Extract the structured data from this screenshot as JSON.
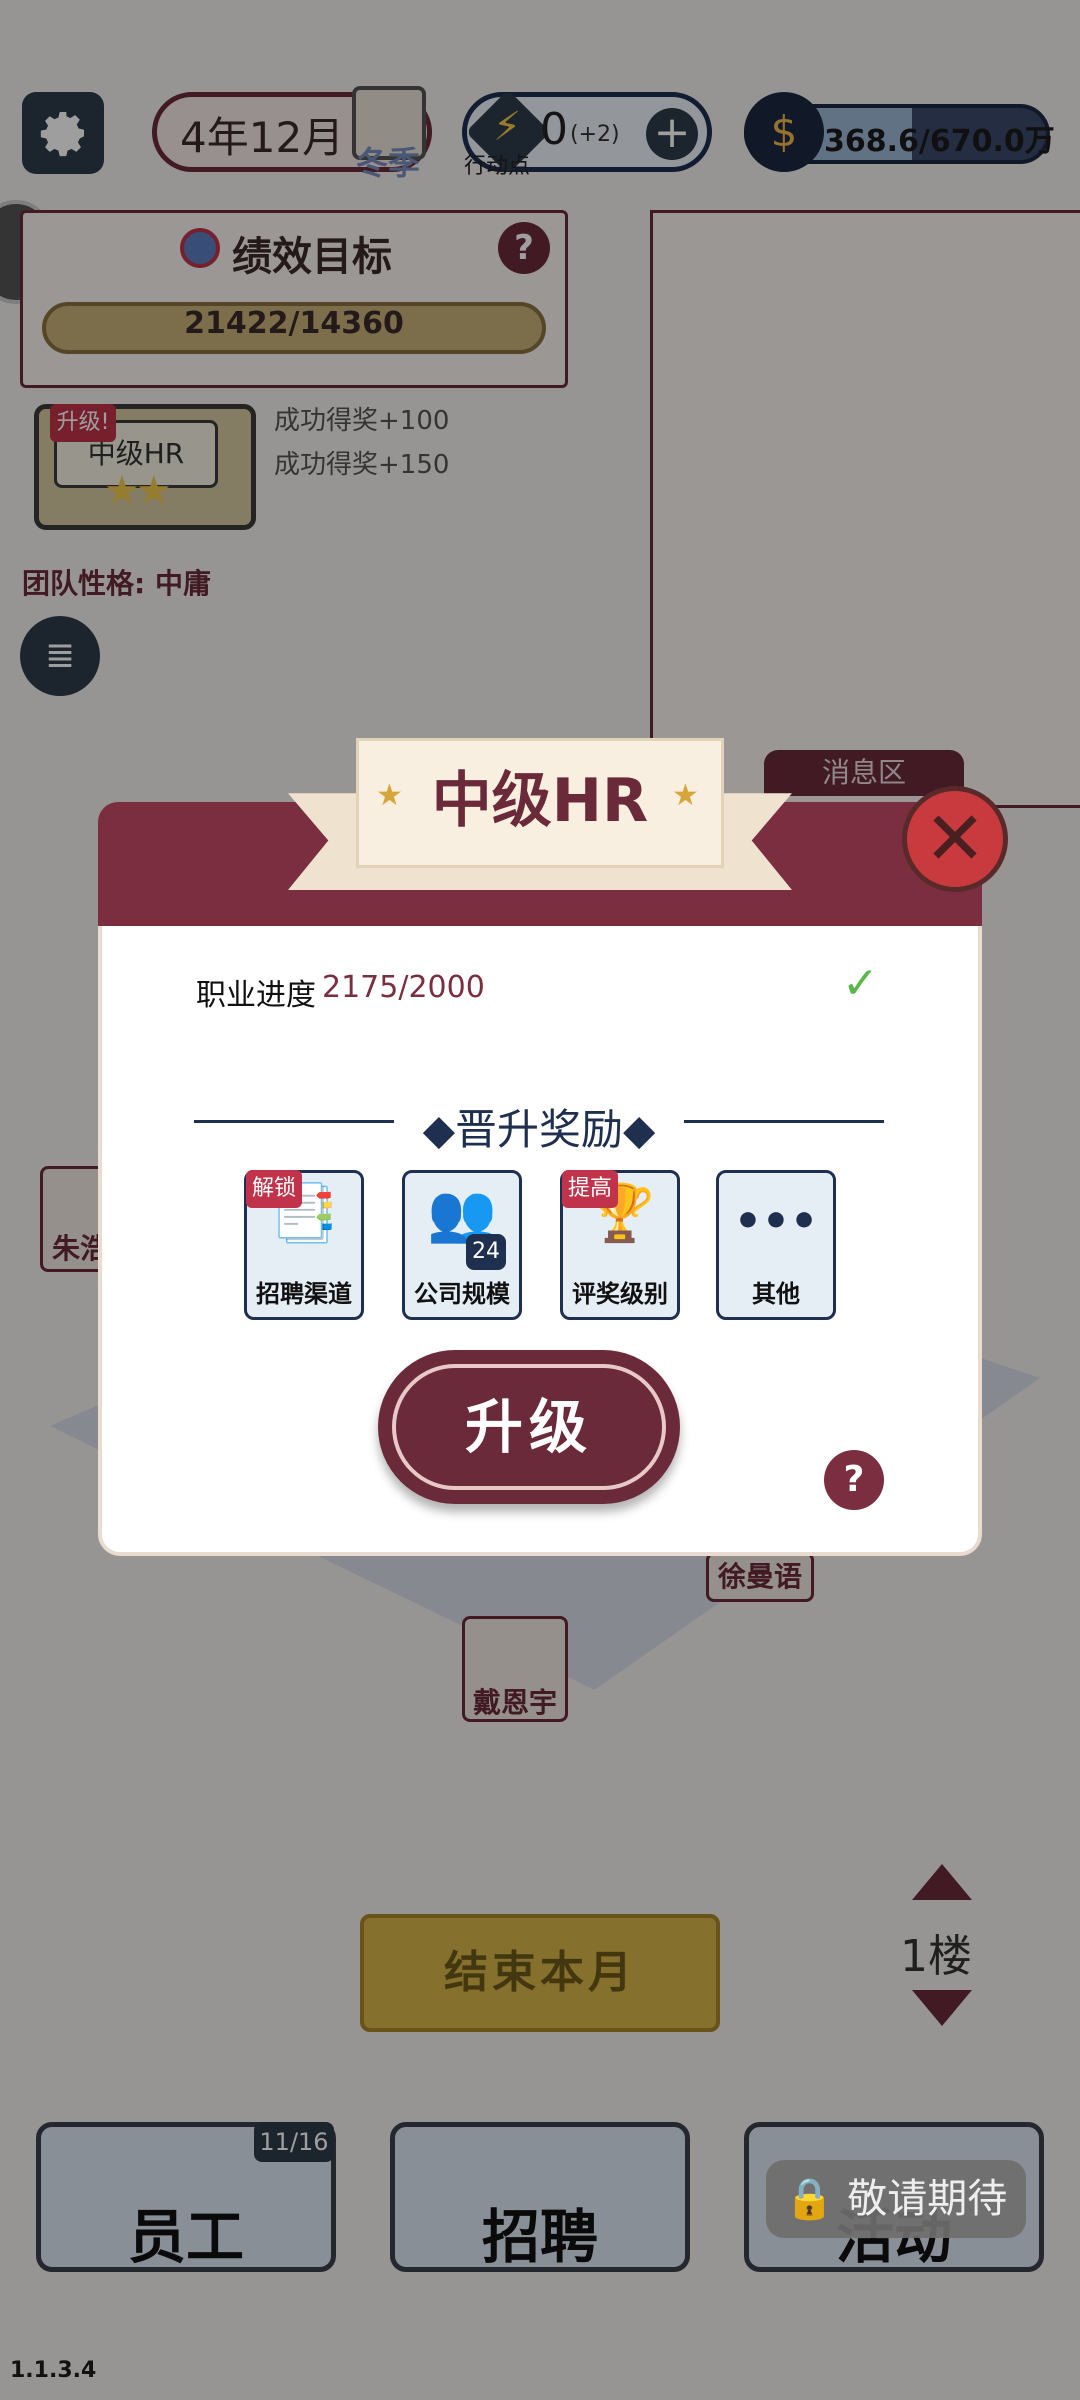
{
  "top_bar": {
    "date": "4年12月",
    "season": "冬季",
    "action_points": "0",
    "action_points_bonus": "(+2)",
    "action_points_label": "行动点",
    "money": "368.6/670.0万",
    "money_fill_fraction": 0.55
  },
  "goal": {
    "title": "绩效目标",
    "help": "?",
    "value": "21422/14360"
  },
  "level_card": {
    "badge": "升级!",
    "name": "中级HR",
    "stars": "★★",
    "reward_1": "成功得奖+100",
    "reward_2": "成功得奖+150"
  },
  "team_trait": "团队性格: 中庸",
  "message_area": {
    "tab": "消息区"
  },
  "characters": [
    "朱浩",
    "徐曼语",
    "戴恩宇"
  ],
  "controls": {
    "end_month": "结束本月",
    "floor": "1楼"
  },
  "nav": {
    "staff": "员工",
    "staff_count": "11/16",
    "recruit": "招聘",
    "activity": "活动",
    "coming_soon": "🔒 敬请期待"
  },
  "version": "1.1.3.4",
  "dialog": {
    "title": "中级HR",
    "close": "✕",
    "progress_label": "职业进度",
    "progress_value": "2175/2000",
    "progress_check": "✓",
    "promo_title": "◆晋升奖励◆",
    "rewards": [
      {
        "label": "招聘渠道",
        "tag": "解锁",
        "icon": "📑"
      },
      {
        "label": "公司规模",
        "num": "24",
        "icon": "👥"
      },
      {
        "label": "评奖级别",
        "tag": "提高",
        "icon": "🏆"
      },
      {
        "label": "其他",
        "icon": "•••"
      }
    ],
    "upgrade": "升级",
    "help": "?"
  }
}
